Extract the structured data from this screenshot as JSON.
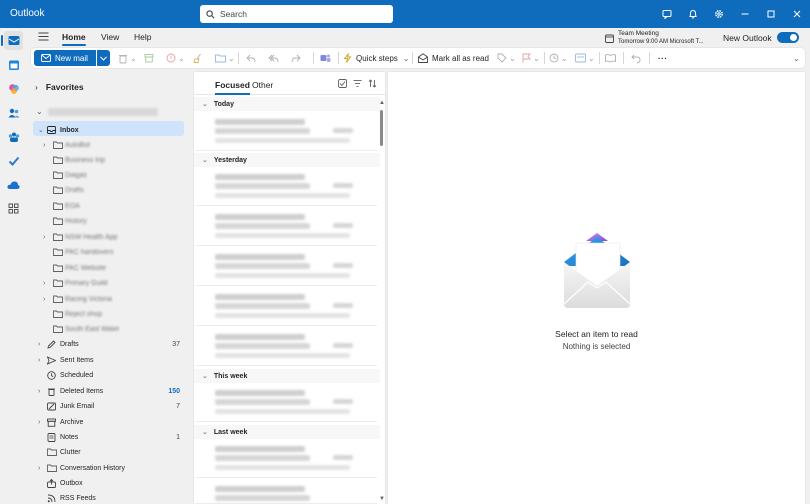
{
  "app": {
    "title": "Outlook"
  },
  "search": {
    "placeholder": "Search"
  },
  "ribbon": {
    "tabs": [
      "Home",
      "View",
      "Help"
    ],
    "active_tab": "Home",
    "meeting_title": "Team Meeting",
    "meeting_detail": "Tomorrow 9:00 AM Microsoft T...",
    "new_outlook_label": "New Outlook",
    "new_outlook_enabled": true
  },
  "toolbar": {
    "new_mail_label": "New mail",
    "quick_steps_label": "Quick steps",
    "mark_all_read_label": "Mark all as read"
  },
  "folders": {
    "favorites_label": "Favorites",
    "account_label": "@",
    "items": [
      {
        "label": "Inbox",
        "count": "",
        "selected": true
      },
      {
        "label": "AutoBot",
        "count": ""
      },
      {
        "label": "Business trip",
        "count": ""
      },
      {
        "label": "Diagas",
        "count": ""
      },
      {
        "label": "Drafts",
        "count": ""
      },
      {
        "label": "EOA",
        "count": ""
      },
      {
        "label": "History",
        "count": ""
      },
      {
        "label": "NSW Health App",
        "count": ""
      },
      {
        "label": "PAC handovers",
        "count": ""
      },
      {
        "label": "PAC Website",
        "count": ""
      },
      {
        "label": "Primary Guild",
        "count": ""
      },
      {
        "label": "Racing Victoria",
        "count": ""
      },
      {
        "label": "Reject shop",
        "count": ""
      },
      {
        "label": "South East Water",
        "count": ""
      },
      {
        "label": "Drafts",
        "count": "37"
      },
      {
        "label": "Sent Items",
        "count": ""
      },
      {
        "label": "Scheduled",
        "count": ""
      },
      {
        "label": "Deleted Items",
        "count": "150"
      },
      {
        "label": "Junk Email",
        "count": "7"
      },
      {
        "label": "Archive",
        "count": ""
      },
      {
        "label": "Notes",
        "count": "1"
      },
      {
        "label": "Clutter",
        "count": ""
      },
      {
        "label": "Conversation History",
        "count": ""
      },
      {
        "label": "Outbox",
        "count": ""
      },
      {
        "label": "RSS Feeds",
        "count": ""
      }
    ]
  },
  "message_list": {
    "tabs": [
      "Focused",
      "Other"
    ],
    "active_tab": "Focused",
    "groups": [
      "Today",
      "Yesterday",
      "This week",
      "Last week"
    ]
  },
  "reading_pane": {
    "primary": "Select an item to read",
    "secondary": "Nothing is selected"
  },
  "colors": {
    "accent": "#0f6cbd",
    "selected": "#cfe4fa"
  }
}
